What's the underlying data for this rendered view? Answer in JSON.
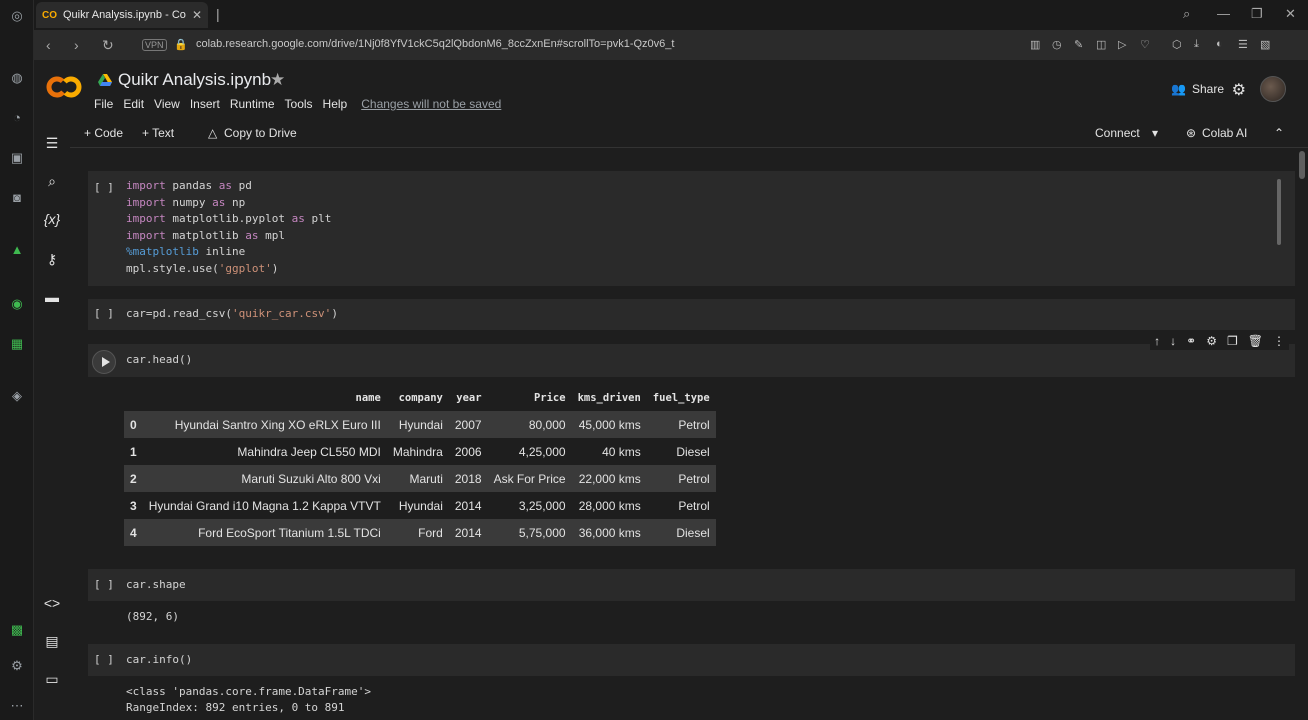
{
  "browser": {
    "tab_title": "Quikr Analysis.ipynb - Cola",
    "tab_logo": "CO",
    "vpn_label": "VPN",
    "url": "colab.research.google.com/drive/1Nj0f8YfV1ckC5q2lQbdonM6_8ccZxnEn#scrollTo=pvk1-Qz0v6_t"
  },
  "header": {
    "title": "Quikr Analysis.ipynb",
    "menu": [
      "File",
      "Edit",
      "View",
      "Insert",
      "Runtime",
      "Tools",
      "Help"
    ],
    "changes_note": "Changes will not be saved",
    "share_label": "Share"
  },
  "toolbar": {
    "code_label": "+ Code",
    "text_label": "+ Text",
    "copy_label": "Copy to Drive",
    "connect_label": "Connect",
    "colab_ai_label": "Colab AI"
  },
  "cells": {
    "c1": {
      "bracket": "[ ]",
      "lines": [
        [
          "kw:import",
          " pandas ",
          "kw:as",
          " pd"
        ],
        [
          "kw:import",
          " numpy ",
          "kw:as",
          " np"
        ],
        [
          "kw:import",
          " matplotlib.pyplot ",
          "kw:as",
          " plt"
        ],
        [
          "kw:import",
          " matplotlib ",
          "kw:as",
          " mpl"
        ],
        [
          "mag:%matplotlib",
          " inline"
        ],
        [
          "mpl.style.use(",
          "str:'ggplot'",
          ")"
        ]
      ]
    },
    "c2": {
      "bracket": "[ ]",
      "lines": [
        [
          "car=pd.read_csv(",
          "str:'quikr_car.csv'",
          ")"
        ]
      ]
    },
    "c3": {
      "code": "car.head()",
      "columns": [
        "",
        "name",
        "company",
        "year",
        "Price",
        "kms_driven",
        "fuel_type"
      ],
      "rows": [
        [
          "0",
          "Hyundai Santro Xing XO eRLX Euro III",
          "Hyundai",
          "2007",
          "80,000",
          "45,000 kms",
          "Petrol"
        ],
        [
          "1",
          "Mahindra Jeep CL550 MDI",
          "Mahindra",
          "2006",
          "4,25,000",
          "40 kms",
          "Diesel"
        ],
        [
          "2",
          "Maruti Suzuki Alto 800 Vxi",
          "Maruti",
          "2018",
          "Ask For Price",
          "22,000 kms",
          "Petrol"
        ],
        [
          "3",
          "Hyundai Grand i10 Magna 1.2 Kappa VTVT",
          "Hyundai",
          "2014",
          "3,25,000",
          "28,000 kms",
          "Petrol"
        ],
        [
          "4",
          "Ford EcoSport Titanium 1.5L TDCi",
          "Ford",
          "2014",
          "5,75,000",
          "36,000 kms",
          "Diesel"
        ]
      ]
    },
    "c4": {
      "bracket": "[ ]",
      "code": "car.shape",
      "output": "(892, 6)"
    },
    "c5": {
      "bracket": "[ ]",
      "code": "car.info()",
      "output_lines": [
        "<class 'pandas.core.frame.DataFrame'>",
        "RangeIndex: 892 entries, 0 to 891"
      ]
    }
  },
  "colors": {
    "background": "#1e1e1e",
    "cell_bg": "#2a2a2a",
    "keyword": "#c586c0",
    "string": "#ce9178",
    "magic": "#569cd6",
    "colab_orange": "#f9ab00"
  }
}
